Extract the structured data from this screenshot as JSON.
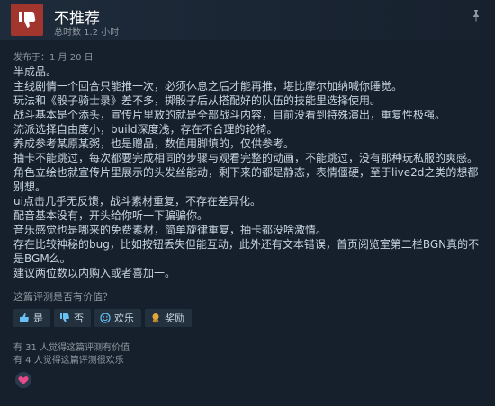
{
  "header": {
    "title": "不推荐",
    "hours": "总时数 1.2 小时"
  },
  "posted": "发布于：1 月 20 日",
  "review_lines": [
    "半成品。",
    "主线剧情一个回合只能推一次，必须休息之后才能再推，堪比摩尔加纳喊你睡觉。",
    "玩法和《骰子骑士录》差不多，掷骰子后从搭配好的队伍的技能里选择使用。",
    "战斗基本是个添头，宣传片里放的就是全部战斗内容，目前没看到特殊演出，重复性极强。",
    "流派选择自由度小，build深度浅，存在不合理的轮椅。",
    "养成参考某原某粥，也是赠品，数值用脚填的，仅供参考。",
    "抽卡不能跳过，每次都要完成相同的步骤与观看完整的动画，不能跳过，没有那种玩私服的爽感。",
    "角色立绘也就宣传片里展示的头发丝能动，剩下来的都是静态，表情僵硬，至于live2d之类的想都别想。",
    "ui点击几乎无反馈，战斗素材重复，不存在差异化。",
    "配音基本没有，开头给你听一下骗骗你。",
    "音乐感觉也是哪来的免费素材，简单旋律重复，抽卡都没啥激情。",
    "存在比较神秘的bug，比如按钮丢失但能互动，此外还有文本错误，首页阅览室第二栏BGN真的不是BGM么。",
    "建议两位数以内购入或者喜加一。"
  ],
  "helpful_prompt": "这篇评测是否有价值？",
  "buttons": {
    "yes": "是",
    "no": "否",
    "funny": "欢乐",
    "award": "奖励"
  },
  "stats": {
    "helpful": "有 31 人觉得这篇评测有价值",
    "funny": "有 4 人觉得这篇评测很欢乐"
  },
  "colors": {
    "thumb_bg": "#a2352e",
    "page_bg": "#16202d",
    "text": "#c6d4df",
    "muted": "#8f98a0"
  }
}
